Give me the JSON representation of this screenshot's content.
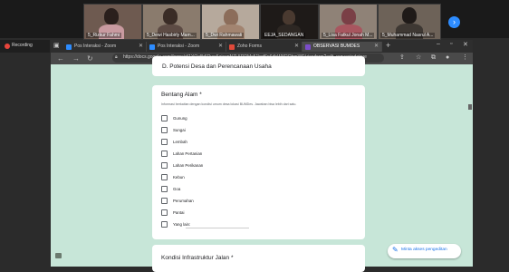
{
  "participants": [
    {
      "name": "5_Rizkur Fahmi"
    },
    {
      "name": "5_Dewi Hasbirly Mam..."
    },
    {
      "name": "5_Dwi Rahmawati"
    },
    {
      "name": "EEJA_SEDANGAN"
    },
    {
      "name": "5_Lisa Fatkul Jonah M..."
    },
    {
      "name": "5_Muhammad Nasrul A..."
    }
  ],
  "recording": {
    "label": "Recording"
  },
  "tabs": [
    {
      "label": "Pos Interaksi - Zoom"
    },
    {
      "label": "Pos Interaksi - Zoom"
    },
    {
      "label": "Zoho Forms"
    },
    {
      "label": "OBSERVASI BUMDES"
    }
  ],
  "address": {
    "url": "https://docs.google.com/forms/d/1YOaBr5Rwe5aisenNZL5RRMc51hqf6n6dhWYRQbmW6/viewform?edit_requested=true"
  },
  "section_heading": "D. Potensi Desa dan Perencanaan Usaha",
  "question": {
    "title": "Bentang Alam *",
    "description": "Informasi berkaitan dengan kondisi umum desa lokasi BUMDes. Jawaban bisa lebih dari satu.",
    "options": [
      "Gunung",
      "Sungai",
      "Lembah",
      "Lahan Pertanian",
      "Lahan Perikanan",
      "Kebun",
      "Goa",
      "Perumahan",
      "Pantai",
      "Yang lain:"
    ]
  },
  "next_question": {
    "title": "Kondisi Infrastruktur Jalan *"
  },
  "request_edit": {
    "label": "Minta akses pengeditan"
  },
  "colors": {
    "form_bg": "#c7e6d8",
    "accent": "#1a73e8",
    "zoom_blue": "#2d8cff"
  }
}
